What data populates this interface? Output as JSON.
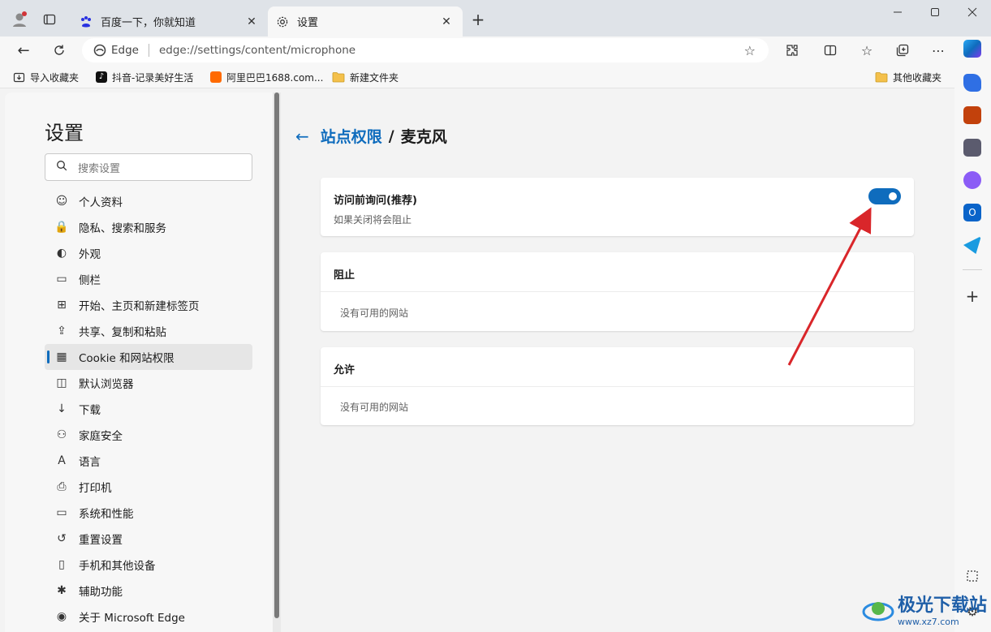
{
  "tabs": [
    {
      "title": "百度一下，你就知道",
      "icon": "baidu-icon"
    },
    {
      "title": "设置",
      "icon": "gear-icon"
    }
  ],
  "address_bar": {
    "site_label": "Edge",
    "url": "edge://settings/content/microphone"
  },
  "bookmarks": [
    {
      "label": "导入收藏夹",
      "icon": "import-icon"
    },
    {
      "label": "抖音-记录美好生活",
      "icon": "douyin-icon"
    },
    {
      "label": "阿里巴巴1688.com...",
      "icon": "alibaba-icon"
    },
    {
      "label": "新建文件夹",
      "icon": "folder-icon"
    },
    {
      "label": "其他收藏夹",
      "icon": "folder-icon"
    }
  ],
  "settings": {
    "heading": "设置",
    "search_placeholder": "搜索设置",
    "nav": [
      {
        "label": "个人资料",
        "icon": "profile-icon"
      },
      {
        "label": "隐私、搜索和服务",
        "icon": "lock-icon"
      },
      {
        "label": "外观",
        "icon": "palette-icon"
      },
      {
        "label": "侧栏",
        "icon": "sidebar-icon"
      },
      {
        "label": "开始、主页和新建标签页",
        "icon": "home-grid-icon"
      },
      {
        "label": "共享、复制和粘贴",
        "icon": "share-icon"
      },
      {
        "label": "Cookie 和网站权限",
        "icon": "cookie-icon"
      },
      {
        "label": "默认浏览器",
        "icon": "browser-icon"
      },
      {
        "label": "下载",
        "icon": "download-icon"
      },
      {
        "label": "家庭安全",
        "icon": "family-icon"
      },
      {
        "label": "语言",
        "icon": "language-icon"
      },
      {
        "label": "打印机",
        "icon": "printer-icon"
      },
      {
        "label": "系统和性能",
        "icon": "laptop-icon"
      },
      {
        "label": "重置设置",
        "icon": "reset-icon"
      },
      {
        "label": "手机和其他设备",
        "icon": "phone-icon"
      },
      {
        "label": "辅助功能",
        "icon": "accessibility-icon"
      },
      {
        "label": "关于 Microsoft Edge",
        "icon": "edge-logo-icon"
      }
    ],
    "active_nav_index": 6
  },
  "page": {
    "breadcrumb_link": "站点权限",
    "breadcrumb_sep": "/",
    "breadcrumb_current": "麦克风",
    "ask_card": {
      "title": "访问前询问(推荐)",
      "subtitle": "如果关闭将会阻止",
      "toggle_on": true
    },
    "block_card": {
      "title": "阻止",
      "empty": "没有可用的网站"
    },
    "allow_card": {
      "title": "允许",
      "empty": "没有可用的网站"
    }
  },
  "watermark": {
    "title": "极光下载站",
    "url": "www.xz7.com"
  },
  "colors": {
    "accent": "#0f6cbd",
    "annotation_arrow": "#d9262a"
  }
}
